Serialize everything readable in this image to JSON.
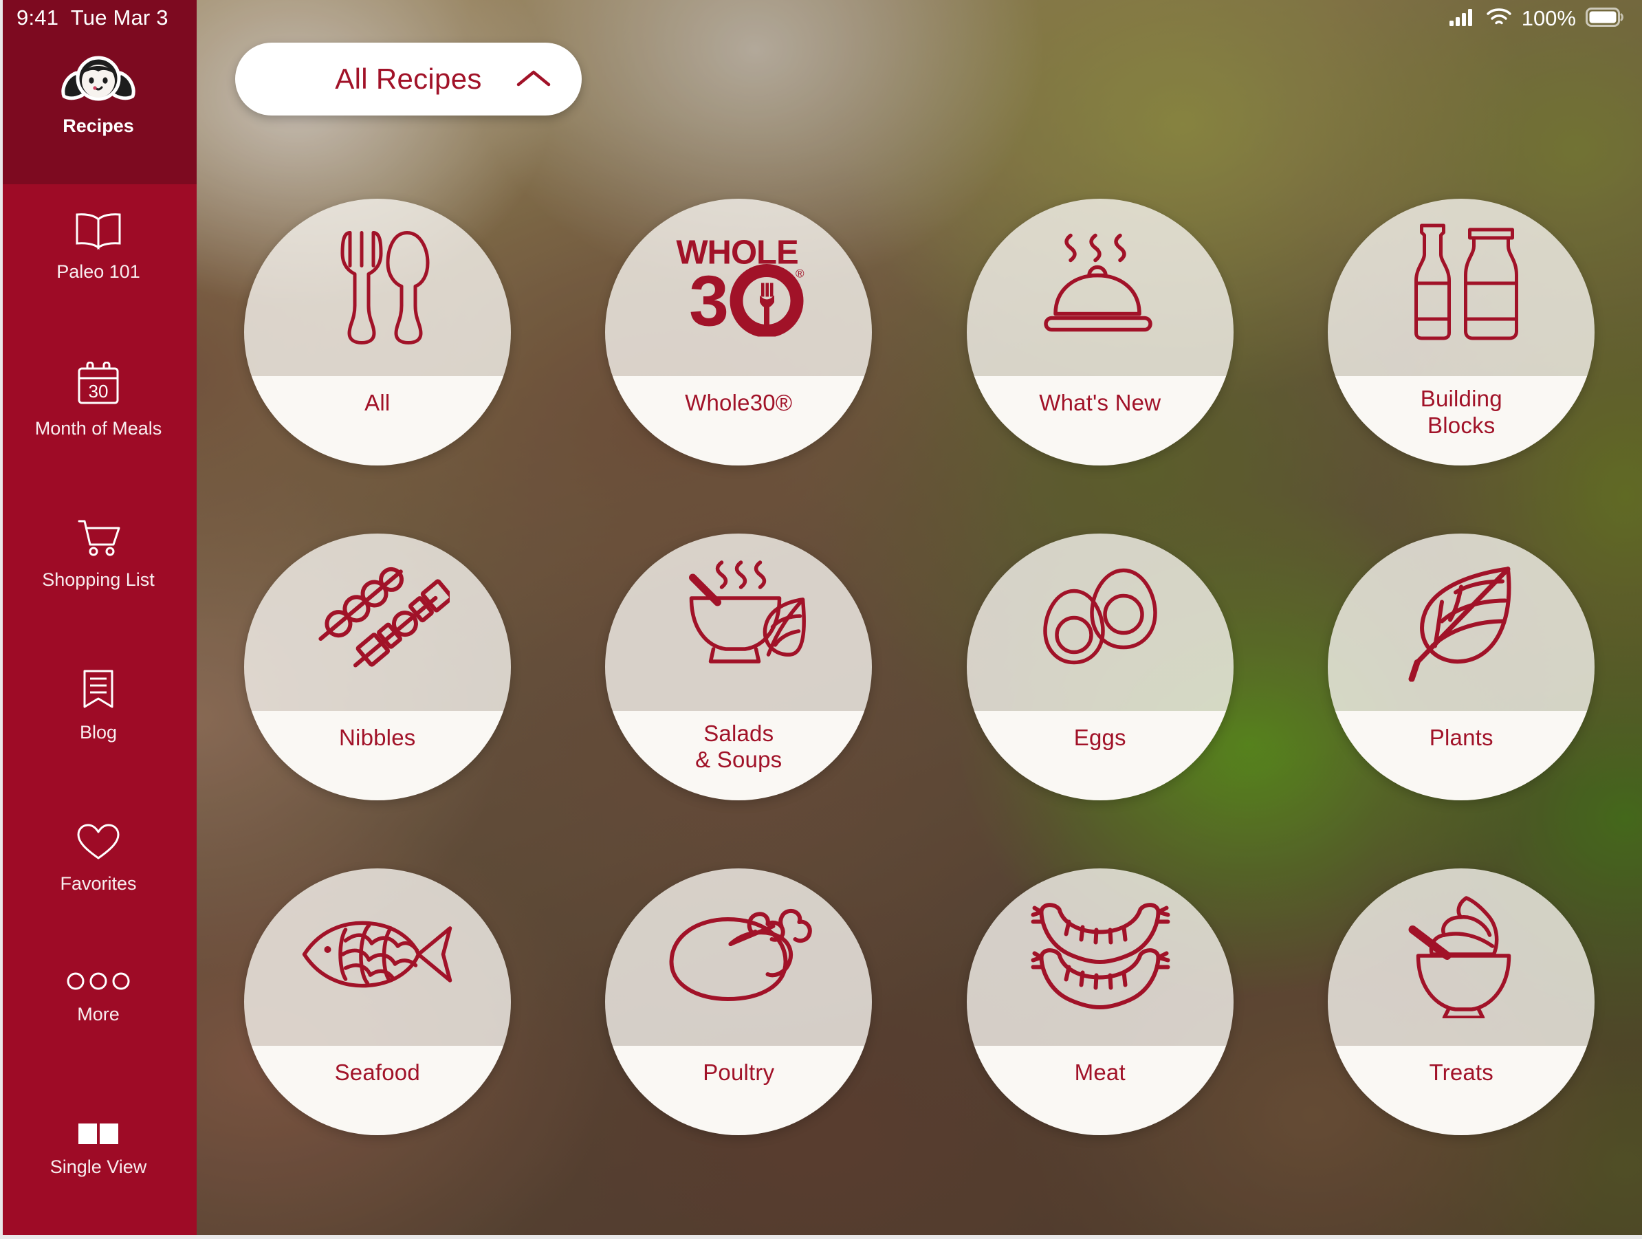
{
  "status_bar": {
    "time": "9:41",
    "date": "Tue Mar 3",
    "battery_percent": "100%",
    "signal_icon": "cellular-signal-icon",
    "wifi_icon": "wifi-icon",
    "battery_icon": "battery-full-icon"
  },
  "brand": {
    "logo_icon": "nom-nom-paleo-girl-logo",
    "accent_color": "#a11228",
    "sidebar_color": "#9e0b26",
    "sidebar_active_color": "#7d0a20"
  },
  "sidebar": {
    "items": [
      {
        "label": "Recipes",
        "icon": "girl-face-logo-icon",
        "active": true
      },
      {
        "label": "Paleo 101",
        "icon": "open-book-icon",
        "active": false
      },
      {
        "label": "Month of Meals",
        "icon": "calendar-30-icon",
        "active": false
      },
      {
        "label": "Shopping List",
        "icon": "shopping-cart-icon",
        "active": false
      },
      {
        "label": "Blog",
        "icon": "bookmark-lines-icon",
        "active": false
      },
      {
        "label": "Favorites",
        "icon": "heart-outline-icon",
        "active": false
      },
      {
        "label": "More",
        "icon": "three-circles-icon",
        "active": false
      },
      {
        "label": "Single View",
        "icon": "two-squares-icon",
        "active": false
      }
    ]
  },
  "filter_dropdown": {
    "label": "All Recipes",
    "chevron_icon": "chevron-up-icon",
    "expanded": true
  },
  "categories": [
    {
      "label": "All",
      "icon": "fork-and-spoon-icon",
      "lines": 1
    },
    {
      "label": "Whole30®",
      "icon": "whole30-logo-icon",
      "lines": 1,
      "logo": {
        "top": "WHOLE",
        "bottom": "30",
        "mark": "®"
      }
    },
    {
      "label": "What's New",
      "icon": "cloche-steam-icon",
      "lines": 1
    },
    {
      "label": "Building\nBlocks",
      "icon": "bottles-icon",
      "lines": 2
    },
    {
      "label": "Nibbles",
      "icon": "skewers-icon",
      "lines": 1
    },
    {
      "label": "Salads\n& Soups",
      "icon": "soup-bowl-leaf-icon",
      "lines": 2
    },
    {
      "label": "Eggs",
      "icon": "egg-halves-icon",
      "lines": 1
    },
    {
      "label": "Plants",
      "icon": "leaf-icon",
      "lines": 1
    },
    {
      "label": "Seafood",
      "icon": "fish-icon",
      "lines": 1
    },
    {
      "label": "Poultry",
      "icon": "roast-chicken-icon",
      "lines": 1
    },
    {
      "label": "Meat",
      "icon": "sausages-icon",
      "lines": 1
    },
    {
      "label": "Treats",
      "icon": "ice-cream-bowl-icon",
      "lines": 1
    }
  ]
}
